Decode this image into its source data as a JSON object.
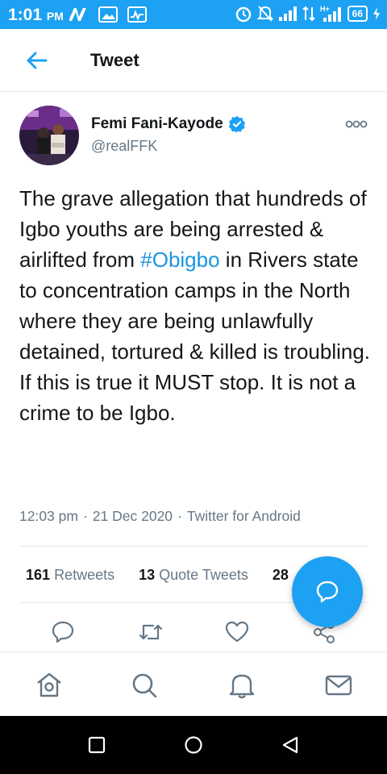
{
  "status_bar": {
    "time": "1:01",
    "ampm": "PM",
    "battery": "66",
    "network_label": "H+"
  },
  "header": {
    "title": "Tweet"
  },
  "tweet": {
    "author_name": "Femi Fani-Kayode",
    "author_handle": "@realFFK",
    "text_before": "The grave allegation that hundreds of Igbo youths are being arrested & airlifted from ",
    "hashtag": "#Obigbo",
    "text_after": " in Rivers state to concentration camps in the North where they are being unlawfully detained, tortured & killed is troubling. If this is true it MUST stop. It is not a crime to be Igbo.",
    "time": "12:03 pm",
    "date": "21 Dec 2020",
    "source": "Twitter for Android"
  },
  "stats": {
    "retweets_count": "161",
    "retweets_label": "Retweets",
    "quote_count": "13",
    "quote_label": "Quote Tweets",
    "likes_count_partial": "28"
  },
  "icons": {
    "back": "arrow-left-icon",
    "verified": "verified-badge-icon",
    "more": "more-options-icon",
    "reply": "reply-icon",
    "retweet": "retweet-icon",
    "like": "heart-icon",
    "share": "share-icon",
    "compose": "compose-reply-icon",
    "home": "home-icon",
    "search": "search-icon",
    "notifications": "bell-icon",
    "messages": "mail-icon"
  },
  "colors": {
    "accent": "#1da1f2",
    "link": "#1b95e0",
    "secondary_text": "#657786"
  }
}
